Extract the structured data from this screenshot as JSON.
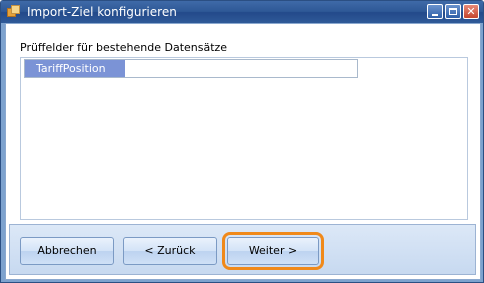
{
  "window": {
    "title": "Import-Ziel konfigurieren",
    "controls": {
      "minimize": "_",
      "maximize": "□",
      "close": "✕"
    }
  },
  "section": {
    "label": "Prüffelder für bestehende Datensätze"
  },
  "grid": {
    "rows": [
      {
        "key": "TariffPosition",
        "value": ""
      }
    ]
  },
  "buttons": {
    "cancel": "Abbrechen",
    "back": "< Zurück",
    "next": "Weiter >"
  },
  "colors": {
    "accent_highlight": "#f0891a",
    "selected_cell": "#7b93d6",
    "titlebar": "#2e5896"
  }
}
